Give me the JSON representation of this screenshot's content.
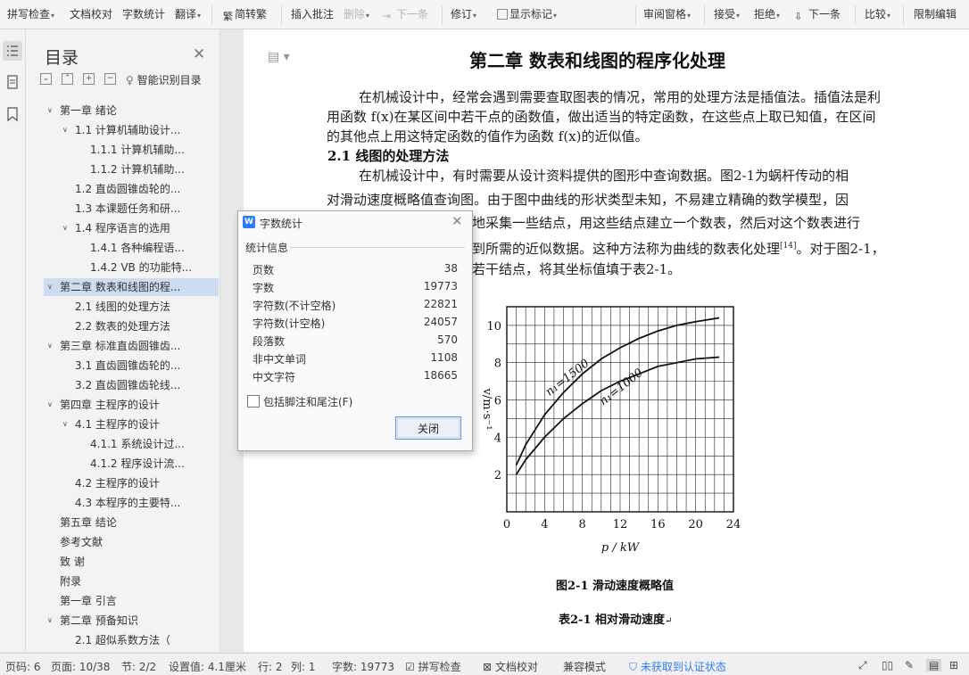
{
  "ribbon": {
    "items": [
      {
        "label": "拼写检查",
        "dropdown": true
      },
      {
        "label": "文档校对",
        "dropdown": false
      },
      {
        "label": "字数统计",
        "dropdown": false
      },
      {
        "label": "翻译",
        "dropdown": true
      },
      {
        "label": "简转繁",
        "dropdown": false
      },
      {
        "label": "插入批注",
        "dropdown": false
      },
      {
        "label": "删除",
        "dropdown": true,
        "disabled": true
      },
      {
        "label": "下一条",
        "dropdown": false,
        "disabled": true
      },
      {
        "label": "修订",
        "dropdown": true
      },
      {
        "label": "显示标记",
        "dropdown": true
      },
      {
        "label": "审阅窗格",
        "dropdown": true
      },
      {
        "label": "接受",
        "dropdown": true
      },
      {
        "label": "拒绝",
        "dropdown": true
      },
      {
        "label": "下一条",
        "dropdown": false
      },
      {
        "label": "比较",
        "dropdown": true
      },
      {
        "label": "限制编辑",
        "dropdown": false
      }
    ]
  },
  "nav": {
    "title": "目录",
    "smart_label": "智能识别目录",
    "items": [
      {
        "label": "第一章  绪论",
        "level": 1,
        "toggle": "expanded"
      },
      {
        "label": "1.1  计算机辅助设计...",
        "level": 2,
        "toggle": "expanded"
      },
      {
        "label": "1.1.1  计算机辅助...",
        "level": 3,
        "toggle": ""
      },
      {
        "label": "1.1.2  计算机辅助...",
        "level": 3,
        "toggle": ""
      },
      {
        "label": "1.2  直齿圆锥齿轮的...",
        "level": 2,
        "toggle": ""
      },
      {
        "label": "1.3  本课题任务和研...",
        "level": 2,
        "toggle": ""
      },
      {
        "label": "1.4  程序语言的选用",
        "level": 2,
        "toggle": "expanded"
      },
      {
        "label": "1.4.1  各种编程语...",
        "level": 3,
        "toggle": ""
      },
      {
        "label": "1.4.2 VB 的功能特...",
        "level": 3,
        "toggle": ""
      },
      {
        "label": "第二章  数表和线图的程...",
        "level": 1,
        "toggle": "expanded",
        "selected": true
      },
      {
        "label": "2.1  线图的处理方法",
        "level": 2,
        "toggle": ""
      },
      {
        "label": "2.2  数表的处理方法",
        "level": 2,
        "toggle": ""
      },
      {
        "label": "第三章  标准直齿圆锥齿...",
        "level": 1,
        "toggle": "expanded"
      },
      {
        "label": "3.1  直齿圆锥齿轮的...",
        "level": 2,
        "toggle": ""
      },
      {
        "label": "3.2  直齿圆锥齿轮线...",
        "level": 2,
        "toggle": ""
      },
      {
        "label": "第四章  主程序的设计",
        "level": 1,
        "toggle": "expanded"
      },
      {
        "label": "4.1  主程序的设计",
        "level": 2,
        "toggle": "expanded"
      },
      {
        "label": "4.1.1  系统设计过...",
        "level": 3,
        "toggle": ""
      },
      {
        "label": "4.1.2  程序设计流...",
        "level": 3,
        "toggle": ""
      },
      {
        "label": "4.2  主程序的设计",
        "level": 2,
        "toggle": ""
      },
      {
        "label": "4.3  本程序的主要特...",
        "level": 2,
        "toggle": ""
      },
      {
        "label": "第五章  结论",
        "level": 1,
        "toggle": ""
      },
      {
        "label": "参考文献",
        "level": 1,
        "toggle": ""
      },
      {
        "label": "致    谢",
        "level": 1,
        "toggle": ""
      },
      {
        "label": "附录",
        "level": 1,
        "toggle": ""
      },
      {
        "label": "第一章  引言",
        "level": 1,
        "toggle": ""
      },
      {
        "label": "第二章  预备知识",
        "level": 1,
        "toggle": "expanded"
      },
      {
        "label": "2.1  超似系数方法（",
        "level": 2,
        "toggle": ""
      }
    ]
  },
  "doc": {
    "heading": "第二章  数表和线图的程序化处理",
    "para1": "在机械设计中，经常会遇到需要查取图表的情况，常用的处理方法是插值法。插值法是利用函数 f(x)在某区间中若干点的函数值，做出适当的特定函数，在这些点上取已知值，在区间的其他点上用这特定函数的值作为函数 f(x)的近似值。",
    "h2": "2.1  线图的处理方法",
    "para2_line1": "在机械设计中，有时需要从设计资料提供的图形中查询数据。图2-1为蜗杆传动的相",
    "para2_line2": "对滑动速度概略值查询图。由于图中曲线的形状类型未知，不易建立精确的数学模型，因",
    "para2_line3": "地采集一些结点，用这些结点建立一个数表，然后对这个数表进行",
    "para2_line4a": "到所需的近似数据。这种方法称为曲线的数表化处理",
    "para2_ref": "[14]",
    "para2_line4b": "。对于图2-1，",
    "para2_line5": "若干结点，将其坐标值填于表2-1。",
    "fig_caption": "图2-1  滑动速度概略值",
    "table_caption": "表2-1  相对滑动速度"
  },
  "chart_data": {
    "type": "line",
    "xlabel": "p / kW",
    "ylabel": "v/m·s⁻¹",
    "xlim": [
      0,
      24
    ],
    "ylim": [
      0,
      11
    ],
    "xticks": [
      "0",
      "4",
      "8",
      "12",
      "16",
      "20",
      "24"
    ],
    "yticks": [
      "2",
      "4",
      "6",
      "8",
      "10"
    ],
    "grid": true,
    "series": [
      {
        "name": "n₁=1500",
        "x": [
          1,
          2,
          4,
          6,
          8,
          10,
          12,
          14,
          16,
          18,
          20,
          22.5
        ],
        "y": [
          2.5,
          3.6,
          5.2,
          6.4,
          7.4,
          8.2,
          8.8,
          9.3,
          9.7,
          10.0,
          10.2,
          10.4
        ]
      },
      {
        "name": "n₁=1000",
        "x": [
          1,
          2,
          4,
          6,
          8,
          10,
          12,
          14,
          16,
          18,
          20,
          22.5
        ],
        "y": [
          2.0,
          2.8,
          4.0,
          5.0,
          5.8,
          6.5,
          7.0,
          7.4,
          7.8,
          8.0,
          8.2,
          8.3
        ]
      }
    ]
  },
  "dialog": {
    "title": "字数统计",
    "section": "统计信息",
    "stats": [
      {
        "label": "页数",
        "value": "38"
      },
      {
        "label": "字数",
        "value": "19773"
      },
      {
        "label": "字符数(不计空格)",
        "value": "22821"
      },
      {
        "label": "字符数(计空格)",
        "value": "24057"
      },
      {
        "label": "段落数",
        "value": "570"
      },
      {
        "label": "非中文单词",
        "value": "1108"
      },
      {
        "label": "中文字符",
        "value": "18665"
      }
    ],
    "checkbox_label": "包括脚注和尾注(F)",
    "close_label": "关闭"
  },
  "status": {
    "page_no": "页码: 6",
    "pages": "页面: 10/38",
    "section": "节: 2/2",
    "setting": "设置值: 4.1厘米",
    "row": "行: 2",
    "col": "列: 1",
    "words": "字数: 19773",
    "spell": "拼写检查",
    "proof": "文档校对",
    "compat": "兼容模式",
    "auth": "未获取到认证状态"
  }
}
